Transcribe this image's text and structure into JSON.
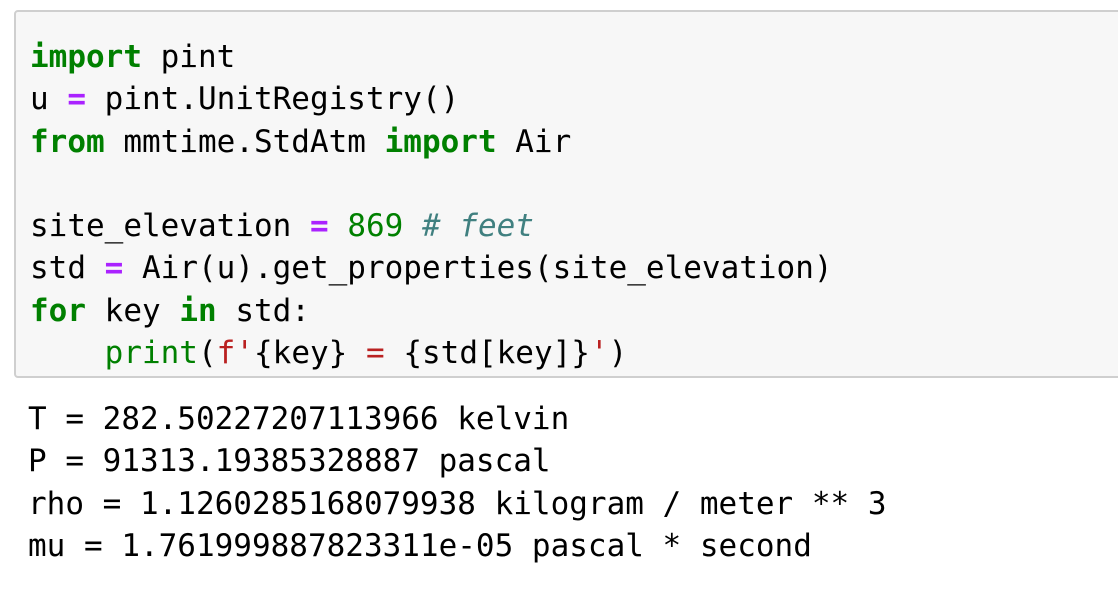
{
  "input_cell": {
    "lines": [
      [
        {
          "t": "import",
          "c": "kw"
        },
        {
          "t": " pint",
          "c": ""
        }
      ],
      [
        {
          "t": "u ",
          "c": ""
        },
        {
          "t": "=",
          "c": "op"
        },
        {
          "t": " pint.UnitRegistry()",
          "c": ""
        }
      ],
      [
        {
          "t": "from",
          "c": "kw"
        },
        {
          "t": " mmtime.StdAtm ",
          "c": ""
        },
        {
          "t": "import",
          "c": "kw"
        },
        {
          "t": " Air",
          "c": ""
        }
      ],
      [],
      [
        {
          "t": "site_elevation ",
          "c": ""
        },
        {
          "t": "=",
          "c": "op"
        },
        {
          "t": " ",
          "c": ""
        },
        {
          "t": "869",
          "c": "num"
        },
        {
          "t": " ",
          "c": ""
        },
        {
          "t": "# feet",
          "c": "cm"
        }
      ],
      [
        {
          "t": "std ",
          "c": ""
        },
        {
          "t": "=",
          "c": "op"
        },
        {
          "t": " Air(u).get_properties(site_elevation)",
          "c": ""
        }
      ],
      [
        {
          "t": "for",
          "c": "kw"
        },
        {
          "t": " key ",
          "c": ""
        },
        {
          "t": "in",
          "c": "kw"
        },
        {
          "t": " std:",
          "c": ""
        }
      ],
      [
        {
          "t": "    ",
          "c": ""
        },
        {
          "t": "print",
          "c": "bi"
        },
        {
          "t": "(",
          "c": ""
        },
        {
          "t": "f",
          "c": "sa"
        },
        {
          "t": "'",
          "c": "st"
        },
        {
          "t": "{key}",
          "c": "si"
        },
        {
          "t": " = ",
          "c": "st"
        },
        {
          "t": "{std[key]}",
          "c": "si"
        },
        {
          "t": "'",
          "c": "st"
        },
        {
          "t": ")",
          "c": ""
        }
      ]
    ]
  },
  "output_cell": {
    "lines": [
      "T = 282.50227207113966 kelvin",
      "P = 91313.19385328887 pascal",
      "rho = 1.1260285168079938 kilogram / meter ** 3",
      "mu = 1.761999887823311e-05 pascal * second"
    ]
  },
  "colors": {
    "keyword": "#008000",
    "operator": "#aa22ff",
    "number": "#008000",
    "comment": "#408080",
    "string": "#ba2121",
    "cell_background": "#f7f7f7",
    "cell_border": "#cfcfcf"
  }
}
